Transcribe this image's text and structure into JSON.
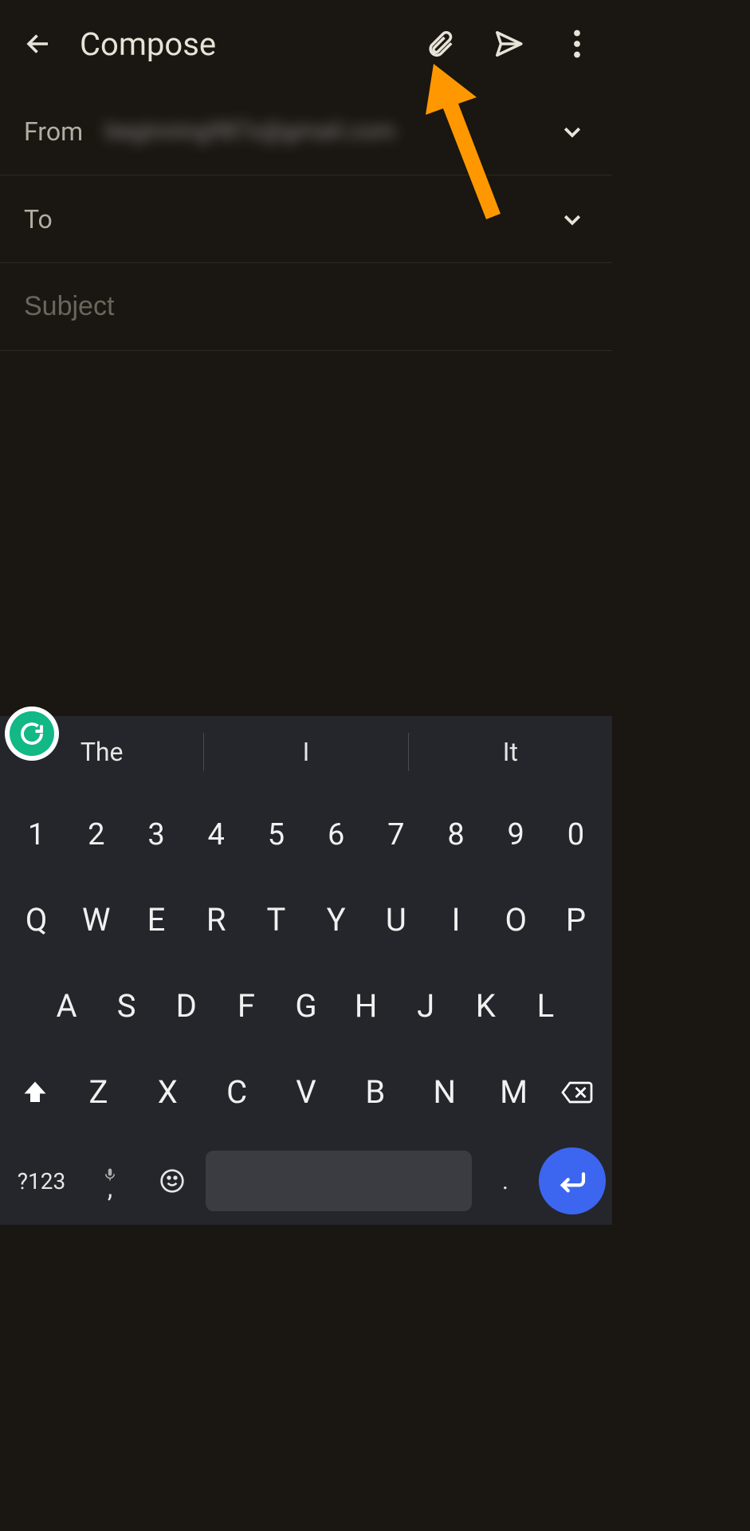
{
  "header": {
    "title": "Compose"
  },
  "fields": {
    "from_label": "From",
    "from_value": "beginning987x@gmail.com",
    "to_label": "To",
    "subject_placeholder": "Subject"
  },
  "suggestions": [
    "The",
    "I",
    "It"
  ],
  "keyboard": {
    "row_nums": [
      "1",
      "2",
      "3",
      "4",
      "5",
      "6",
      "7",
      "8",
      "9",
      "0"
    ],
    "row_qwerty": [
      "Q",
      "W",
      "E",
      "R",
      "T",
      "Y",
      "U",
      "I",
      "O",
      "P"
    ],
    "row_asdf": [
      "A",
      "S",
      "D",
      "F",
      "G",
      "H",
      "J",
      "K",
      "L"
    ],
    "row_zxcv": [
      "Z",
      "X",
      "C",
      "V",
      "B",
      "N",
      "M"
    ],
    "symbols_label": "?123",
    "comma_label": ",",
    "period_label": "."
  }
}
